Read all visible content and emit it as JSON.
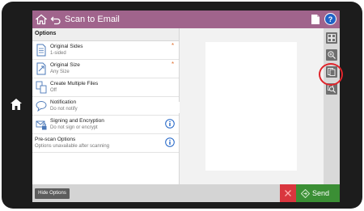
{
  "header": {
    "title": "Scan to Email"
  },
  "options_panel": {
    "heading": "Options",
    "items": [
      {
        "label": "Original Sides",
        "value": "1-sided",
        "required": "*"
      },
      {
        "label": "Original Size",
        "value": "Any Size",
        "required": "*"
      },
      {
        "label": "Create Multiple Files",
        "value": "Off"
      },
      {
        "label": "Notification",
        "value": "Do not notify"
      },
      {
        "label": "Signing and Encryption",
        "value": "Do not sign or encrypt"
      },
      {
        "label": "Pre-scan Options",
        "value": "Options unavailable after scanning"
      }
    ]
  },
  "footer": {
    "hide_options_label": "Hide Options",
    "send_label": "Send"
  },
  "colors": {
    "title_bar": "#a0648c",
    "send_button": "#3b8f35",
    "cancel_button": "#d9363e",
    "highlight": "#e0242b"
  },
  "icons": {
    "home": "home-icon",
    "back": "back-arrow-icon",
    "document": "document-icon",
    "help": "help-icon",
    "thumbnails": "thumbnail-grid-icon",
    "zoom": "zoom-in-icon",
    "page_view": "page-view-icon",
    "zoom_out": "zoom-out-icon"
  }
}
